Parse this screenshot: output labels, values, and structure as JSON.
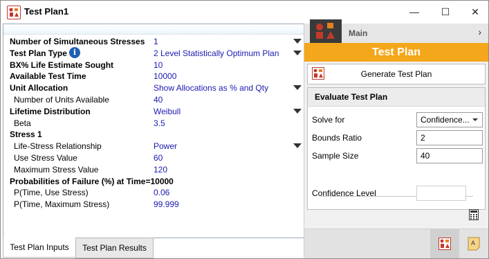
{
  "window": {
    "title": "Test Plan1"
  },
  "titlebar": {
    "minimize": "—",
    "maximize": "☐",
    "close": "✕"
  },
  "properties": [
    {
      "label": "Number of Simultaneous Stresses",
      "value": "1",
      "bold": true,
      "dropdown": true
    },
    {
      "label": "Test Plan Type",
      "value": "2 Level Statistically Optimum Plan",
      "bold": true,
      "dropdown": true,
      "info": "i"
    },
    {
      "label": "BX% Life Estimate Sought",
      "value": "10",
      "bold": true
    },
    {
      "label": "Available Test Time",
      "value": "10000",
      "bold": true
    },
    {
      "label": "Unit Allocation",
      "value": "Show Allocations as % and Qty",
      "bold": true,
      "dropdown": true
    },
    {
      "label": "Number of Units Available",
      "value": "40",
      "indent": true
    },
    {
      "label": "Lifetime Distribution",
      "value": "Weibull",
      "bold": true,
      "dropdown": true
    },
    {
      "label": "Beta",
      "value": "3.5",
      "indent": true
    },
    {
      "label": "Stress 1",
      "value": "",
      "bold": true
    },
    {
      "label": "Life-Stress Relationship",
      "value": "Power",
      "indent": true,
      "dropdown": true
    },
    {
      "label": "Use Stress Value",
      "value": "60",
      "indent": true
    },
    {
      "label": "Maximum Stress Value",
      "value": "120",
      "indent": true
    },
    {
      "label": "Probabilities of Failure (%) at Time=10000",
      "value": "",
      "bold": true
    },
    {
      "label": "P(Time, Use Stress)",
      "value": "0.06",
      "indent": true
    },
    {
      "label": "P(Time, Maximum Stress)",
      "value": "99.999",
      "indent": true
    }
  ],
  "tabs": [
    "Test Plan Inputs",
    "Test Plan Results"
  ],
  "right": {
    "main_label": "Main",
    "chevron": "›",
    "banner": "Test Plan",
    "generate_label": "Generate Test Plan",
    "evaluate": {
      "title": "Evaluate Test Plan",
      "solve_for_label": "Solve for",
      "solve_for_value": "Confidence...",
      "bounds_ratio_label": "Bounds Ratio",
      "bounds_ratio_value": "2",
      "sample_size_label": "Sample Size",
      "sample_size_value": "40",
      "confidence_level_label": "Confidence Level",
      "confidence_level_value": ""
    },
    "bottom_note_icon": "A"
  },
  "colors": {
    "accent_orange": "#f4a71a",
    "value_blue": "#1a1ab0",
    "logo_red": "#c0392b"
  }
}
